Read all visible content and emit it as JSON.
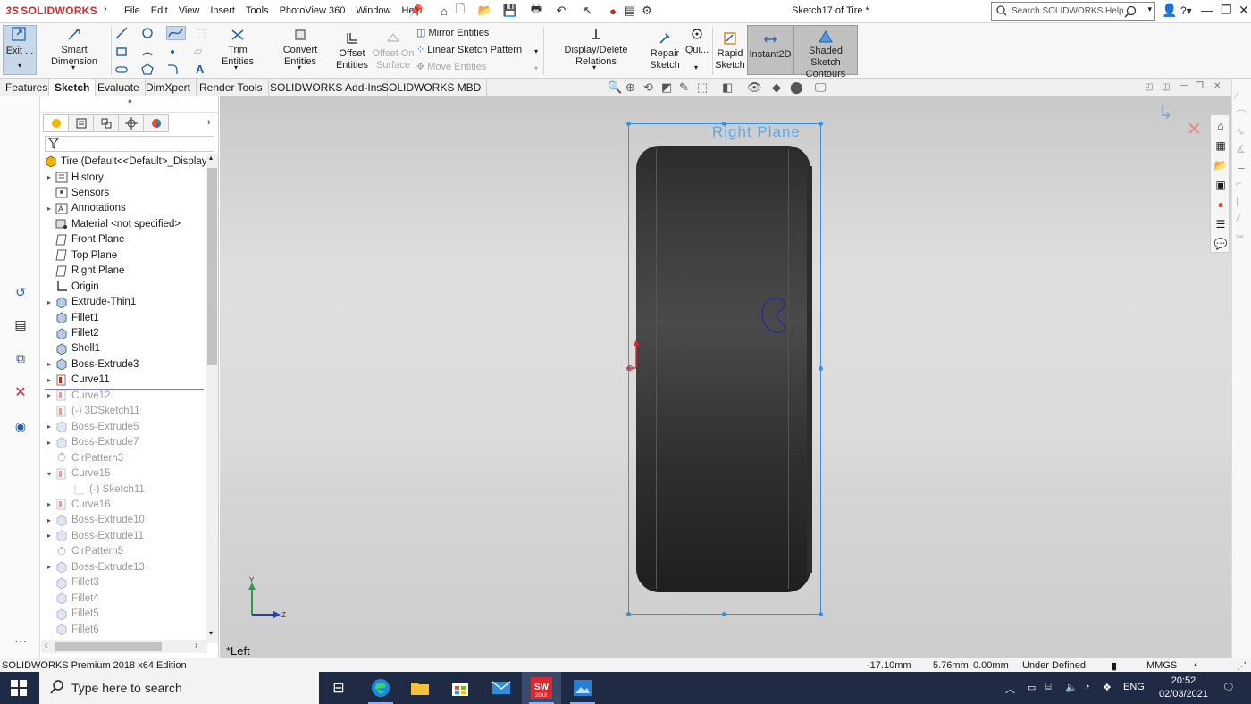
{
  "app": {
    "logo_text": "SOLIDWORKS",
    "logo_mark": "3S",
    "menus": [
      "File",
      "Edit",
      "View",
      "Insert",
      "Tools",
      "PhotoView 360",
      "Window",
      "Help"
    ],
    "document_title": "Sketch17 of Tire *",
    "search_placeholder": "Search SOLIDWORKS Help"
  },
  "commands": {
    "exit_sketch": "Exit ...",
    "smart_dimension": "Smart Dimension",
    "trim_entities": "Trim Entities",
    "convert_entities": "Convert Entities",
    "offset_entities_1": "Offset",
    "offset_entities_2": "Entities",
    "offset_on_surface_1": "Offset On",
    "offset_on_surface_2": "Surface",
    "mirror_entities": "Mirror Entities",
    "linear_sketch_pattern": "Linear Sketch Pattern",
    "move_entities": "Move Entities",
    "display_delete_relations": "Display/Delete Relations",
    "repair_sketch_1": "Repair",
    "repair_sketch_2": "Sketch",
    "quick_snaps": "Qui...",
    "rapid_sketch_1": "Rapid",
    "rapid_sketch_2": "Sketch",
    "instant2d": "Instant2D",
    "shaded_contours_1": "Shaded Sketch",
    "shaded_contours_2": "Contours"
  },
  "tabs": [
    "Features",
    "Sketch",
    "Evaluate",
    "DimXpert",
    "Render Tools",
    "SOLIDWORKS Add-Ins",
    "SOLIDWORKS MBD"
  ],
  "active_tab": "Sketch",
  "tree": {
    "root": "Tire  (Default<<Default>_Display",
    "items": [
      {
        "label": "History",
        "expand": true,
        "suppressed": false
      },
      {
        "label": "Sensors",
        "expand": false,
        "suppressed": false
      },
      {
        "label": "Annotations",
        "expand": true,
        "suppressed": false
      },
      {
        "label": "Material <not specified>",
        "expand": false,
        "suppressed": false
      },
      {
        "label": "Front Plane",
        "expand": false,
        "suppressed": false
      },
      {
        "label": "Top Plane",
        "expand": false,
        "suppressed": false
      },
      {
        "label": "Right Plane",
        "expand": false,
        "suppressed": false
      },
      {
        "label": "Origin",
        "expand": false,
        "suppressed": false
      },
      {
        "label": "Extrude-Thin1",
        "expand": true,
        "suppressed": false
      },
      {
        "label": "Fillet1",
        "expand": false,
        "suppressed": false
      },
      {
        "label": "Fillet2",
        "expand": false,
        "suppressed": false
      },
      {
        "label": "Shell1",
        "expand": false,
        "suppressed": false
      },
      {
        "label": "Boss-Extrude3",
        "expand": true,
        "suppressed": false
      },
      {
        "label": "Curve11",
        "expand": true,
        "suppressed": false
      },
      {
        "label": "Curve12",
        "expand": true,
        "suppressed": true
      },
      {
        "label": "(-) 3DSketch11",
        "expand": false,
        "suppressed": true
      },
      {
        "label": "Boss-Extrude5",
        "expand": true,
        "suppressed": true
      },
      {
        "label": "Boss-Extrude7",
        "expand": true,
        "suppressed": true
      },
      {
        "label": "CirPattern3",
        "expand": false,
        "suppressed": true
      },
      {
        "label": "Curve15",
        "expand": "open",
        "suppressed": true
      },
      {
        "label": "(-) Sketch11",
        "expand": false,
        "suppressed": true,
        "child": true
      },
      {
        "label": "Curve16",
        "expand": true,
        "suppressed": true
      },
      {
        "label": "Boss-Extrude10",
        "expand": true,
        "suppressed": true
      },
      {
        "label": "Boss-Extrude11",
        "expand": true,
        "suppressed": true
      },
      {
        "label": "CirPattern5",
        "expand": false,
        "suppressed": true
      },
      {
        "label": "Boss-Extrude13",
        "expand": true,
        "suppressed": true
      },
      {
        "label": "Fillet3",
        "expand": false,
        "suppressed": true
      },
      {
        "label": "Fillet4",
        "expand": false,
        "suppressed": true
      },
      {
        "label": "Fillet5",
        "expand": false,
        "suppressed": true
      },
      {
        "label": "Fillet6",
        "expand": false,
        "suppressed": true
      }
    ]
  },
  "viewport": {
    "plane_label": "Right Plane",
    "view_name": "*Left",
    "triad_y": "Y",
    "triad_z": "Z"
  },
  "status": {
    "edition": "SOLIDWORKS Premium 2018 x64 Edition",
    "x": "-17.10mm",
    "y": "5.76mm",
    "z": "0.00mm",
    "sketch_state": "Under Defined",
    "units": "MMGS"
  },
  "taskbar": {
    "search_placeholder": "Type here to search",
    "language": "ENG",
    "time": "20:52",
    "date": "02/03/2021",
    "sw_badge": "2018"
  },
  "colors": {
    "accent": "#d8292f",
    "selection": "#3a8fe0",
    "plane_label": "#5ca8e8",
    "taskbar": "#1f2a44"
  }
}
